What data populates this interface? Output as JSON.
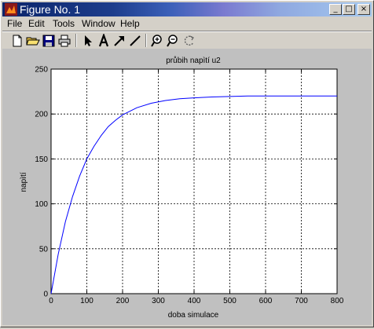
{
  "window": {
    "title": "Figure No. 1"
  },
  "title_buttons": {
    "minimize": "_",
    "maximize": "□",
    "close": "×"
  },
  "menu": [
    "File",
    "Edit",
    "Tools",
    "Window",
    "Help"
  ],
  "toolbar_icons": [
    "new-file-icon",
    "open-folder-icon",
    "save-icon",
    "print-icon",
    "select-arrow-icon",
    "text-insert-icon",
    "arrow-insert-icon",
    "line-insert-icon",
    "zoom-in-icon",
    "zoom-out-icon",
    "rotate-icon"
  ],
  "colors": {
    "line": "#0000ff",
    "axes_bg": "#ffffff",
    "figure_bg": "#c0c0c0",
    "title_bar": "#0a246a"
  },
  "chart_data": {
    "type": "line",
    "title": "průbih napìtí u2",
    "xlabel": "doba simulace",
    "ylabel": "napìtí",
    "xlim": [
      0,
      800
    ],
    "ylim": [
      0,
      250
    ],
    "xticks": [
      0,
      100,
      200,
      300,
      400,
      500,
      600,
      700,
      800
    ],
    "yticks": [
      0,
      50,
      100,
      150,
      200,
      250
    ],
    "grid": true,
    "series": [
      {
        "color": "#0000ff",
        "x": [
          0,
          20,
          40,
          60,
          80,
          100,
          120,
          140,
          160,
          180,
          200,
          240,
          280,
          320,
          360,
          400,
          450,
          500,
          550,
          600,
          700,
          800
        ],
        "y": [
          0,
          44,
          80,
          108,
          131,
          150,
          164,
          176,
          186,
          193,
          199,
          207,
          212,
          215,
          217,
          218,
          219,
          219.5,
          220,
          220,
          220,
          220
        ]
      }
    ]
  }
}
